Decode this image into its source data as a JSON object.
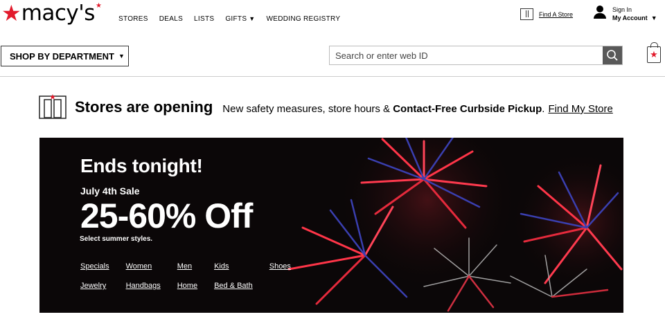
{
  "logo": {
    "star": "★",
    "word": "macy's",
    "tm_star": "★"
  },
  "topnav": [
    {
      "label": "STORES"
    },
    {
      "label": "DEALS"
    },
    {
      "label": "LISTS"
    },
    {
      "label": "GIFTS",
      "caret": "▼"
    },
    {
      "label": "WEDDING REGISTRY"
    }
  ],
  "find_store": {
    "label": "Find A Store"
  },
  "account": {
    "sign_in": "Sign In",
    "my_account": "My Account",
    "caret": "▼"
  },
  "department": {
    "label": "SHOP BY DEPARTMENT",
    "caret": "▼"
  },
  "search": {
    "placeholder": "Search or enter web ID",
    "value": ""
  },
  "bag": {
    "icon": "★"
  },
  "stores_banner": {
    "heading": "Stores are opening",
    "text": "New safety measures, store hours & ",
    "bold": "Contact-Free Curbside Pickup",
    "period": ".",
    "link": "Find My Store"
  },
  "hero": {
    "headline": "Ends tonight!",
    "sub": "July 4th Sale",
    "big": "25-60% Off",
    "small": "Select summer styles.",
    "links": [
      "Specials",
      "Women",
      "Men",
      "Kids",
      "Shoes",
      "Jewelry",
      "Handbags",
      "Home",
      "Bed & Bath"
    ]
  },
  "colors": {
    "brand_red": "#e21a2c",
    "hero_bg": "#0b0708",
    "search_button": "#595959"
  }
}
